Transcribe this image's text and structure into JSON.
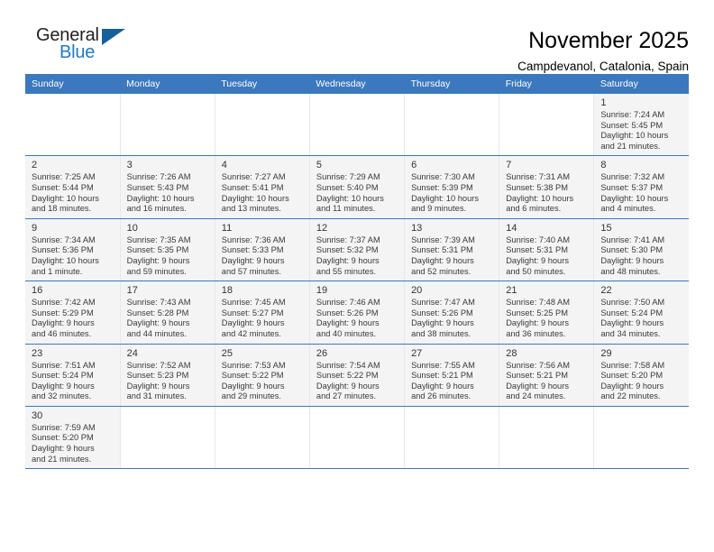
{
  "brand": {
    "name_dark": "General",
    "name_blue": "Blue",
    "flag_icon": "blue-triangle-flag"
  },
  "header": {
    "title": "November 2025",
    "subtitle": "Campdevanol, Catalonia, Spain"
  },
  "colors": {
    "header_blue": "#3b78bd",
    "brand_blue": "#2079c7",
    "flag_blue": "#16609e",
    "shade_gray": "#f4f4f4",
    "grid_line": "#e7e7e7"
  },
  "weekdays": [
    "Sunday",
    "Monday",
    "Tuesday",
    "Wednesday",
    "Thursday",
    "Friday",
    "Saturday"
  ],
  "weeks": [
    [
      {
        "day": "",
        "info": ""
      },
      {
        "day": "",
        "info": ""
      },
      {
        "day": "",
        "info": ""
      },
      {
        "day": "",
        "info": ""
      },
      {
        "day": "",
        "info": ""
      },
      {
        "day": "",
        "info": ""
      },
      {
        "day": "1",
        "info": "Sunrise: 7:24 AM\nSunset: 5:45 PM\nDaylight: 10 hours\nand 21 minutes."
      }
    ],
    [
      {
        "day": "2",
        "info": "Sunrise: 7:25 AM\nSunset: 5:44 PM\nDaylight: 10 hours\nand 18 minutes."
      },
      {
        "day": "3",
        "info": "Sunrise: 7:26 AM\nSunset: 5:43 PM\nDaylight: 10 hours\nand 16 minutes."
      },
      {
        "day": "4",
        "info": "Sunrise: 7:27 AM\nSunset: 5:41 PM\nDaylight: 10 hours\nand 13 minutes."
      },
      {
        "day": "5",
        "info": "Sunrise: 7:29 AM\nSunset: 5:40 PM\nDaylight: 10 hours\nand 11 minutes."
      },
      {
        "day": "6",
        "info": "Sunrise: 7:30 AM\nSunset: 5:39 PM\nDaylight: 10 hours\nand 9 minutes."
      },
      {
        "day": "7",
        "info": "Sunrise: 7:31 AM\nSunset: 5:38 PM\nDaylight: 10 hours\nand 6 minutes."
      },
      {
        "day": "8",
        "info": "Sunrise: 7:32 AM\nSunset: 5:37 PM\nDaylight: 10 hours\nand 4 minutes."
      }
    ],
    [
      {
        "day": "9",
        "info": "Sunrise: 7:34 AM\nSunset: 5:36 PM\nDaylight: 10 hours\nand 1 minute."
      },
      {
        "day": "10",
        "info": "Sunrise: 7:35 AM\nSunset: 5:35 PM\nDaylight: 9 hours\nand 59 minutes."
      },
      {
        "day": "11",
        "info": "Sunrise: 7:36 AM\nSunset: 5:33 PM\nDaylight: 9 hours\nand 57 minutes."
      },
      {
        "day": "12",
        "info": "Sunrise: 7:37 AM\nSunset: 5:32 PM\nDaylight: 9 hours\nand 55 minutes."
      },
      {
        "day": "13",
        "info": "Sunrise: 7:39 AM\nSunset: 5:31 PM\nDaylight: 9 hours\nand 52 minutes."
      },
      {
        "day": "14",
        "info": "Sunrise: 7:40 AM\nSunset: 5:31 PM\nDaylight: 9 hours\nand 50 minutes."
      },
      {
        "day": "15",
        "info": "Sunrise: 7:41 AM\nSunset: 5:30 PM\nDaylight: 9 hours\nand 48 minutes."
      }
    ],
    [
      {
        "day": "16",
        "info": "Sunrise: 7:42 AM\nSunset: 5:29 PM\nDaylight: 9 hours\nand 46 minutes."
      },
      {
        "day": "17",
        "info": "Sunrise: 7:43 AM\nSunset: 5:28 PM\nDaylight: 9 hours\nand 44 minutes."
      },
      {
        "day": "18",
        "info": "Sunrise: 7:45 AM\nSunset: 5:27 PM\nDaylight: 9 hours\nand 42 minutes."
      },
      {
        "day": "19",
        "info": "Sunrise: 7:46 AM\nSunset: 5:26 PM\nDaylight: 9 hours\nand 40 minutes."
      },
      {
        "day": "20",
        "info": "Sunrise: 7:47 AM\nSunset: 5:26 PM\nDaylight: 9 hours\nand 38 minutes."
      },
      {
        "day": "21",
        "info": "Sunrise: 7:48 AM\nSunset: 5:25 PM\nDaylight: 9 hours\nand 36 minutes."
      },
      {
        "day": "22",
        "info": "Sunrise: 7:50 AM\nSunset: 5:24 PM\nDaylight: 9 hours\nand 34 minutes."
      }
    ],
    [
      {
        "day": "23",
        "info": "Sunrise: 7:51 AM\nSunset: 5:24 PM\nDaylight: 9 hours\nand 32 minutes."
      },
      {
        "day": "24",
        "info": "Sunrise: 7:52 AM\nSunset: 5:23 PM\nDaylight: 9 hours\nand 31 minutes."
      },
      {
        "day": "25",
        "info": "Sunrise: 7:53 AM\nSunset: 5:22 PM\nDaylight: 9 hours\nand 29 minutes."
      },
      {
        "day": "26",
        "info": "Sunrise: 7:54 AM\nSunset: 5:22 PM\nDaylight: 9 hours\nand 27 minutes."
      },
      {
        "day": "27",
        "info": "Sunrise: 7:55 AM\nSunset: 5:21 PM\nDaylight: 9 hours\nand 26 minutes."
      },
      {
        "day": "28",
        "info": "Sunrise: 7:56 AM\nSunset: 5:21 PM\nDaylight: 9 hours\nand 24 minutes."
      },
      {
        "day": "29",
        "info": "Sunrise: 7:58 AM\nSunset: 5:20 PM\nDaylight: 9 hours\nand 22 minutes."
      }
    ],
    [
      {
        "day": "30",
        "info": "Sunrise: 7:59 AM\nSunset: 5:20 PM\nDaylight: 9 hours\nand 21 minutes."
      },
      {
        "day": "",
        "info": ""
      },
      {
        "day": "",
        "info": ""
      },
      {
        "day": "",
        "info": ""
      },
      {
        "day": "",
        "info": ""
      },
      {
        "day": "",
        "info": ""
      },
      {
        "day": "",
        "info": ""
      }
    ]
  ]
}
